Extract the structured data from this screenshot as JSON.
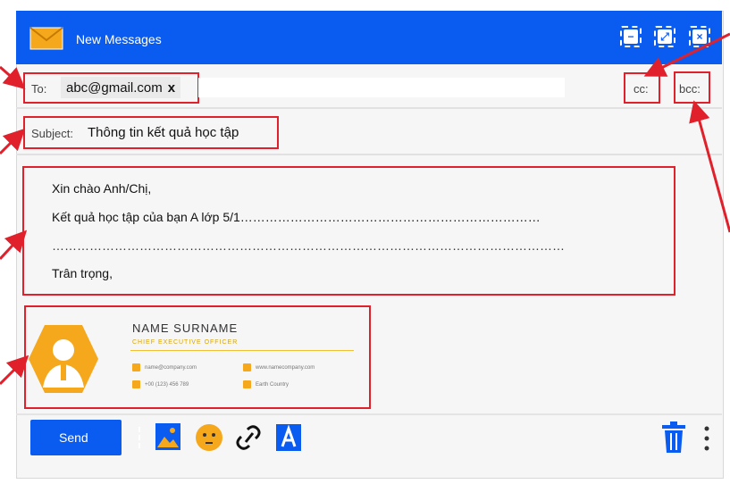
{
  "window": {
    "title": "New Messages",
    "controls": {
      "minimize": "−",
      "maximize": "⤢",
      "close": "×"
    }
  },
  "to": {
    "label": "To:",
    "recipient": "abc@gmail.com",
    "remove": "x"
  },
  "cc": {
    "label": "cc:"
  },
  "bcc": {
    "label": "bcc:"
  },
  "subject": {
    "label": "Subject:",
    "value": "Thông tin kết quả học tập"
  },
  "body": {
    "greeting": "Xin chào Anh/Chị,",
    "line1": "Kết quả học tập của bạn A lớp 5/1………………………………………………………………",
    "line2": "……………………………………………………………………………………………………………",
    "closing": "Trân trọng,"
  },
  "signature": {
    "name": "NAME SURNAME",
    "title": "CHIEF EXECUTIVE OFFICER",
    "email": "name@company.com",
    "website": "www.namecompany.com",
    "phone": "+00 (123) 456 789",
    "location": "Earth Country"
  },
  "toolbar": {
    "send_label": "Send"
  },
  "colors": {
    "primary": "#0a5cf0",
    "highlight_box": "#e0202a",
    "accent": "#f5a81c"
  }
}
